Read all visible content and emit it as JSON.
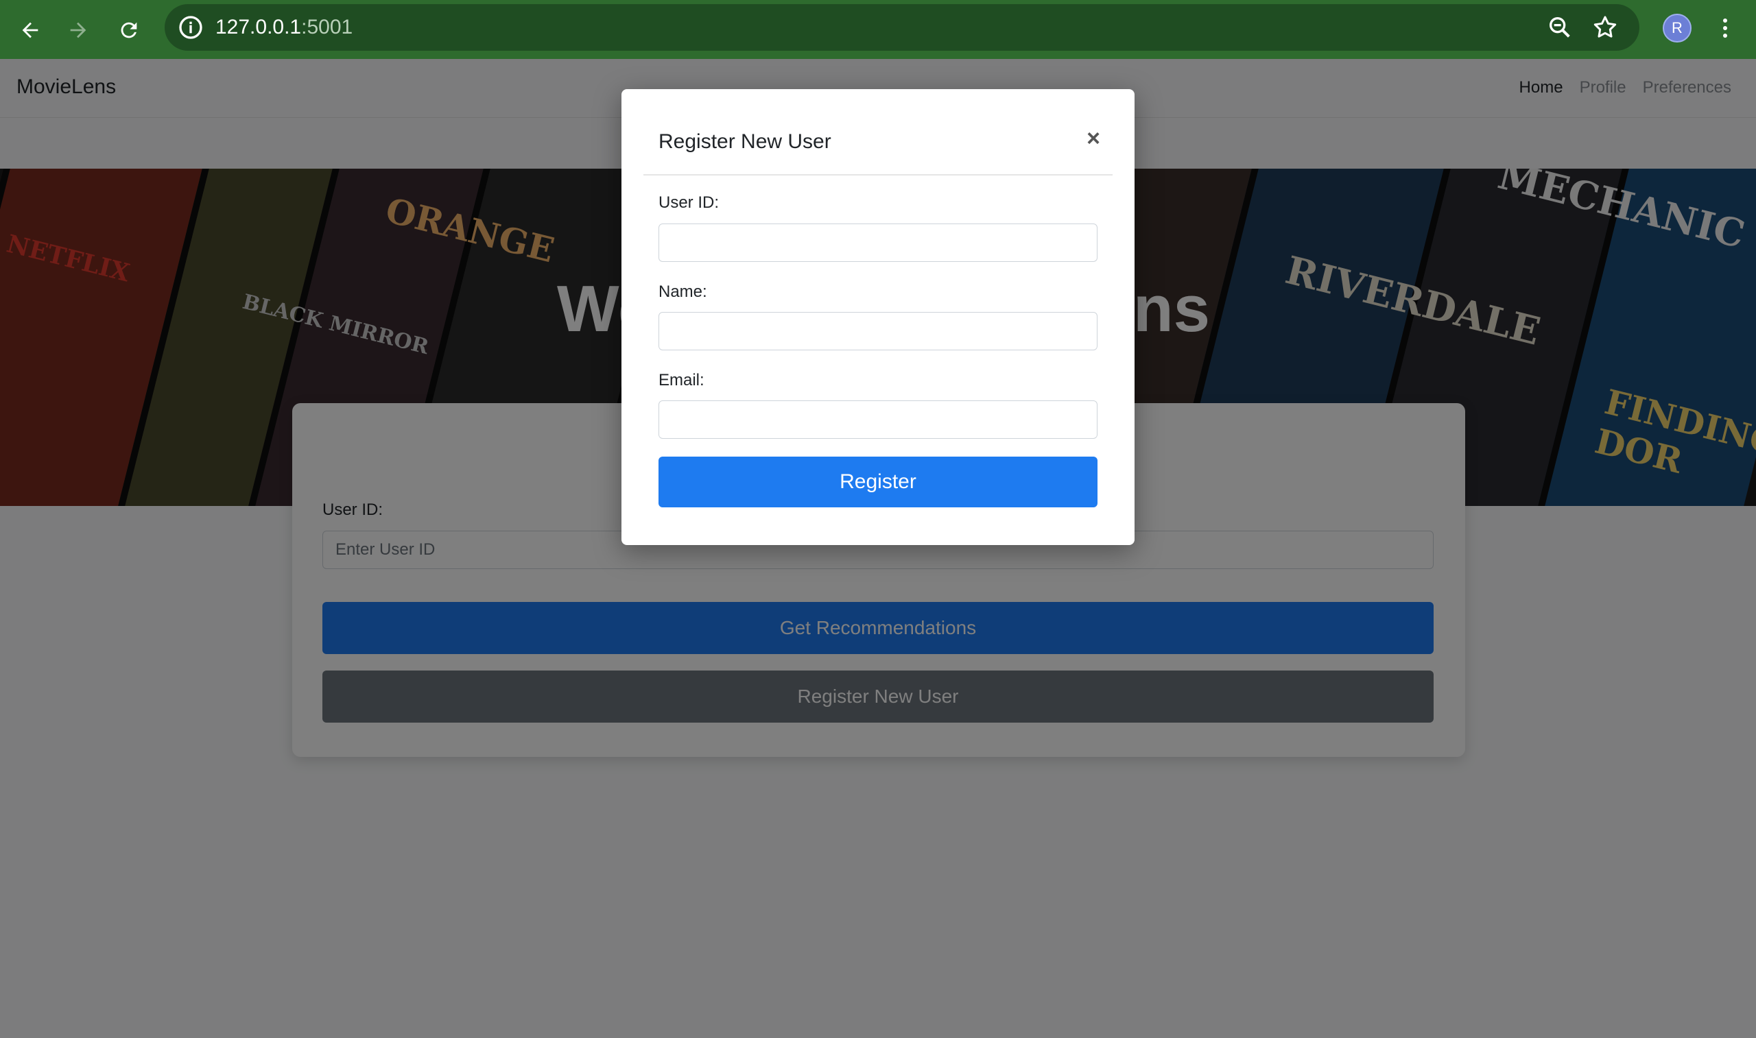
{
  "browser": {
    "url_host": "127.0.0.1",
    "url_port": ":5001",
    "avatar_initial": "R",
    "icons": [
      "back-arrow-icon",
      "forward-arrow-icon",
      "reload-icon",
      "info-icon",
      "zoom-icon",
      "star-icon",
      "kebab-menu-icon"
    ]
  },
  "navbar": {
    "brand": "MovieLens",
    "links": [
      {
        "label": "Home",
        "active": true
      },
      {
        "label": "Profile",
        "active": false
      },
      {
        "label": "Preferences",
        "active": false
      }
    ]
  },
  "hero": {
    "title_left": "We",
    "title_right": "ns",
    "posters": [
      "NETFLIX",
      "ORANGE",
      "BLACK MIRROR",
      "RIVERDALE",
      "MECHANIC",
      "FINDING DOR"
    ]
  },
  "card": {
    "user_id_label": "User ID:",
    "user_id_placeholder": "Enter User ID",
    "recommend_button": "Get Recommendations",
    "register_button": "Register New User"
  },
  "modal": {
    "title": "Register New User",
    "close_symbol": "×",
    "fields": {
      "user_id_label": "User ID:",
      "name_label": "Name:",
      "email_label": "Email:"
    },
    "submit_label": "Register"
  },
  "colors": {
    "primary": "#1e7bf0",
    "secondary": "#6c757d",
    "chrome": "#2e6b2e"
  }
}
